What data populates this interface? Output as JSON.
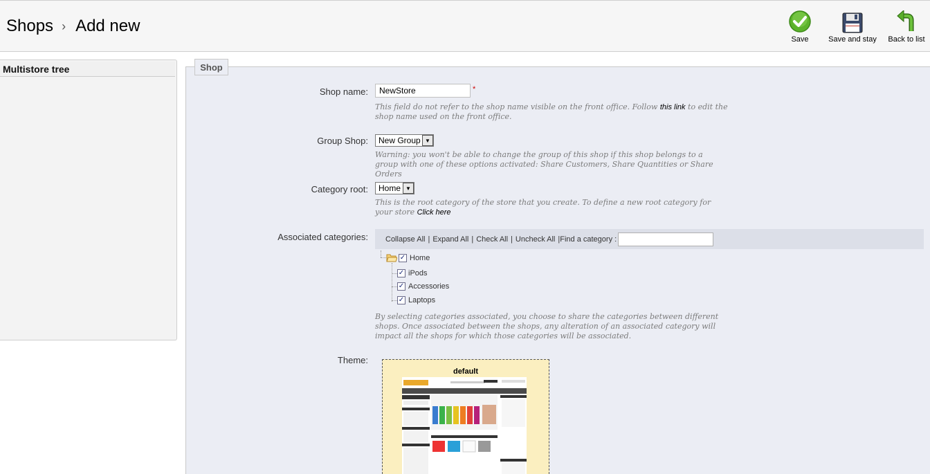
{
  "breadcrumb": {
    "parent": "Shops",
    "separator": "›",
    "current": "Add new"
  },
  "toolbar": {
    "save": "Save",
    "save_and_stay": "Save and stay",
    "back_to_list": "Back to list"
  },
  "sidebar": {
    "title": "Multistore tree"
  },
  "form": {
    "legend": "Shop",
    "shop_name": {
      "label": "Shop name:",
      "value": "NewStore",
      "required_mark": "*",
      "hint_before": "This field do not refer to the shop name visible on the front office. Follow",
      "hint_link": "this link",
      "hint_after": "to edit the shop name used on the front office."
    },
    "group_shop": {
      "label": "Group Shop:",
      "selected": "New Group",
      "hint": "Warning: you won't be able to change the group of this shop if this shop belongs to a group with one of these options activated: Share Customers, Share Quantities or Share Orders"
    },
    "category_root": {
      "label": "Category root:",
      "selected": "Home",
      "hint_before": "This is the root category of the store that you create. To define a new root category for your store",
      "hint_link": "Click here"
    },
    "associated_categories": {
      "label": "Associated categories:",
      "collapse_all": "Collapse All",
      "expand_all": "Expand All",
      "check_all": "Check All",
      "uncheck_all": "Uncheck All",
      "find_label": "Find a category :",
      "tree": {
        "root": {
          "name": "Home",
          "checked": true
        },
        "children": [
          {
            "name": "iPods",
            "checked": true
          },
          {
            "name": "Accessories",
            "checked": true
          },
          {
            "name": "Laptops",
            "checked": true
          }
        ]
      },
      "hint": "By selecting categories associated, you choose to share the categories between different shops. Once associated between the shops, any alteration of an associated category will impact all the shops for which those categories will be associated."
    },
    "theme": {
      "label": "Theme:",
      "name": "default"
    }
  },
  "colors": {
    "panel_bg": "#ebedf4",
    "save_green": "#5cb32b",
    "theme_bg": "#fbefc0"
  }
}
